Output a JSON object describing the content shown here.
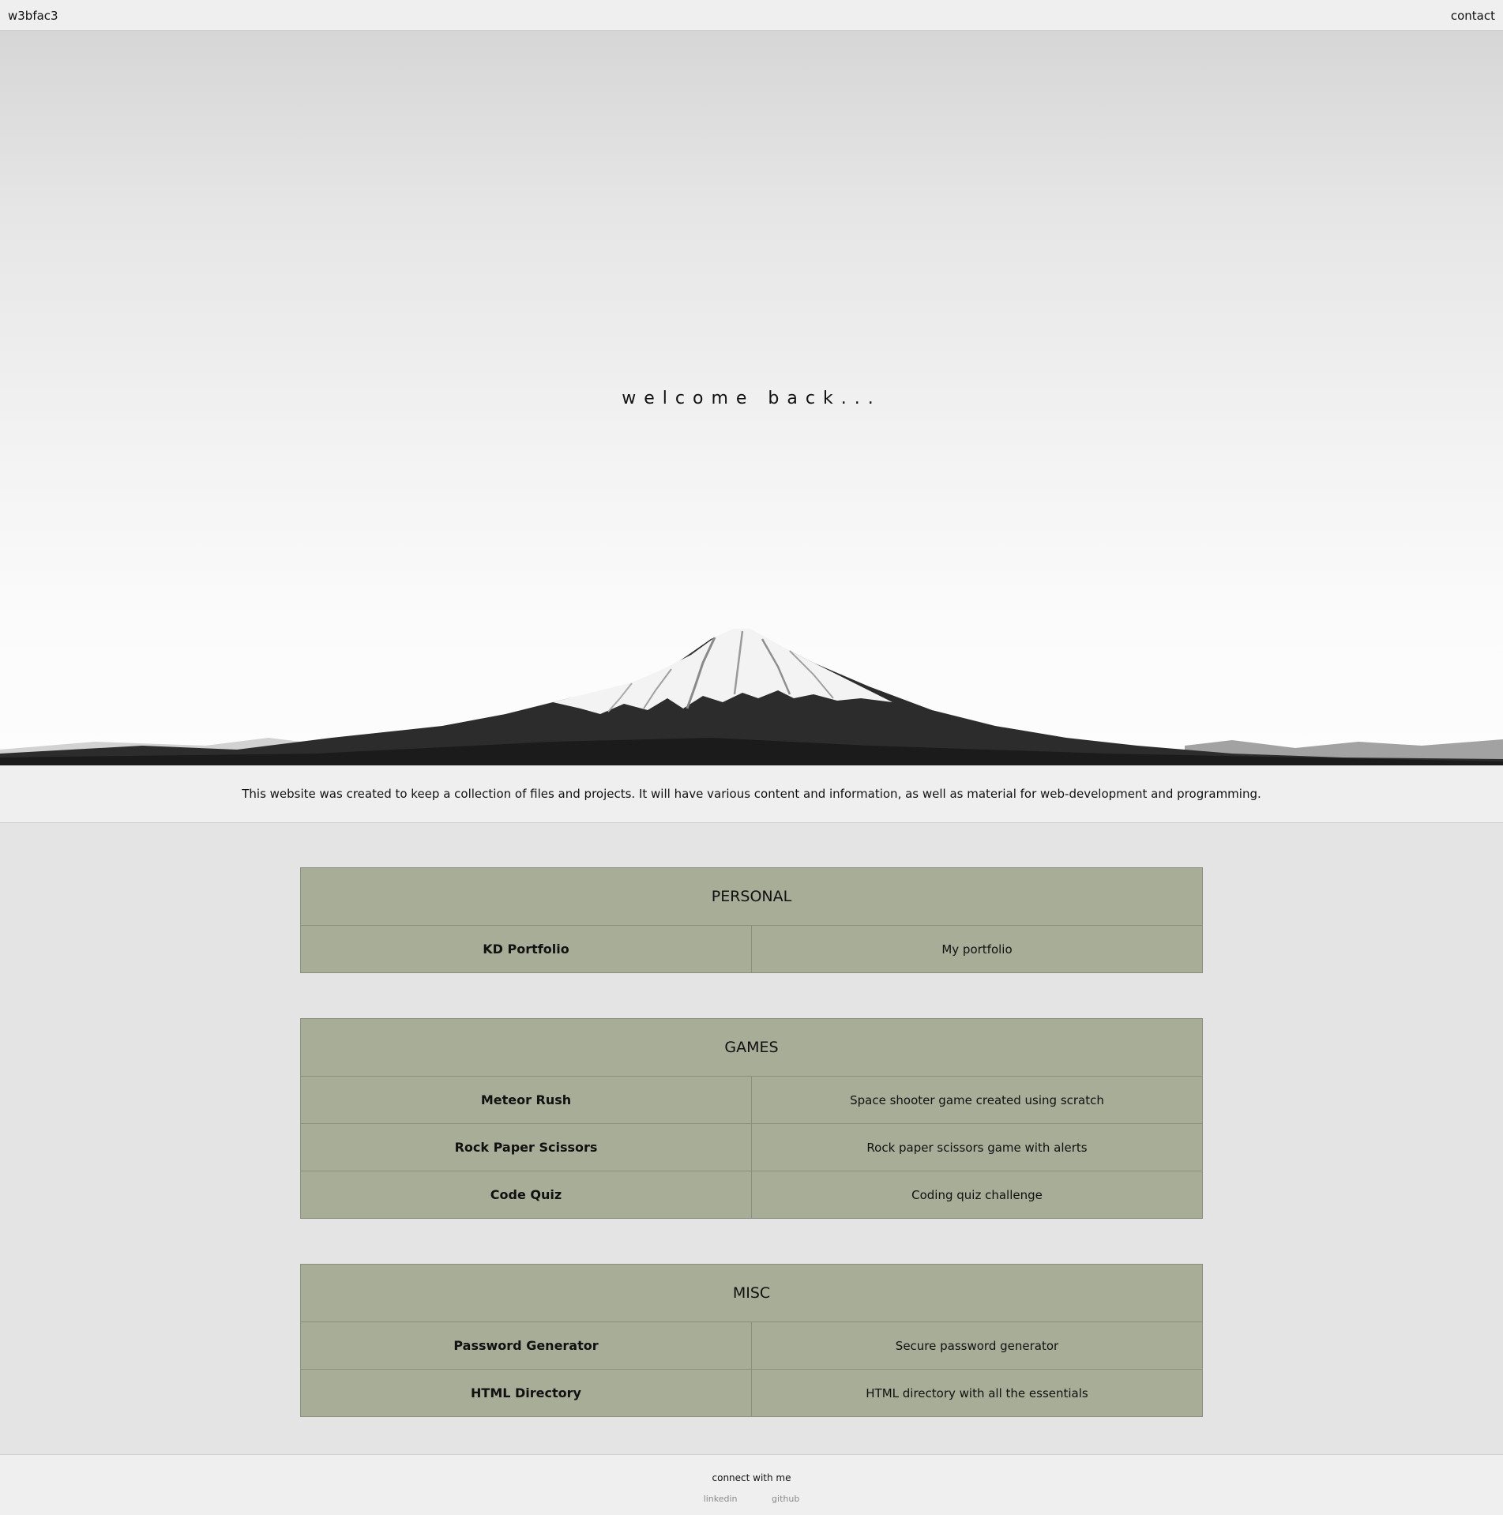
{
  "header": {
    "brand": "w3bfac3",
    "contact": "contact"
  },
  "hero": {
    "title": "welcome back..."
  },
  "intro": {
    "text": "This website was created to keep a collection of files and projects. It will have various content and information, as well as material for web-development and programming."
  },
  "sections": [
    {
      "title": "PERSONAL",
      "rows": [
        {
          "name": "KD Portfolio",
          "description": "My portfolio"
        }
      ]
    },
    {
      "title": "GAMES",
      "rows": [
        {
          "name": "Meteor Rush",
          "description": "Space shooter game created using scratch"
        },
        {
          "name": "Rock Paper Scissors",
          "description": "Rock paper scissors game with alerts"
        },
        {
          "name": "Code Quiz",
          "description": "Coding quiz challenge"
        }
      ]
    },
    {
      "title": "MISC",
      "rows": [
        {
          "name": "Password Generator",
          "description": "Secure password generator"
        },
        {
          "name": "HTML Directory",
          "description": "HTML directory with all the essentials"
        }
      ]
    }
  ],
  "footer": {
    "connect": "connect with me",
    "links": [
      "linkedin",
      "github"
    ]
  },
  "colors": {
    "table_bg": "#a7ad97",
    "table_border": "#8a8f7e",
    "page_bg": "#e4e4e4",
    "bar_bg": "#efefef",
    "footer_link": "#8a8a8a"
  }
}
